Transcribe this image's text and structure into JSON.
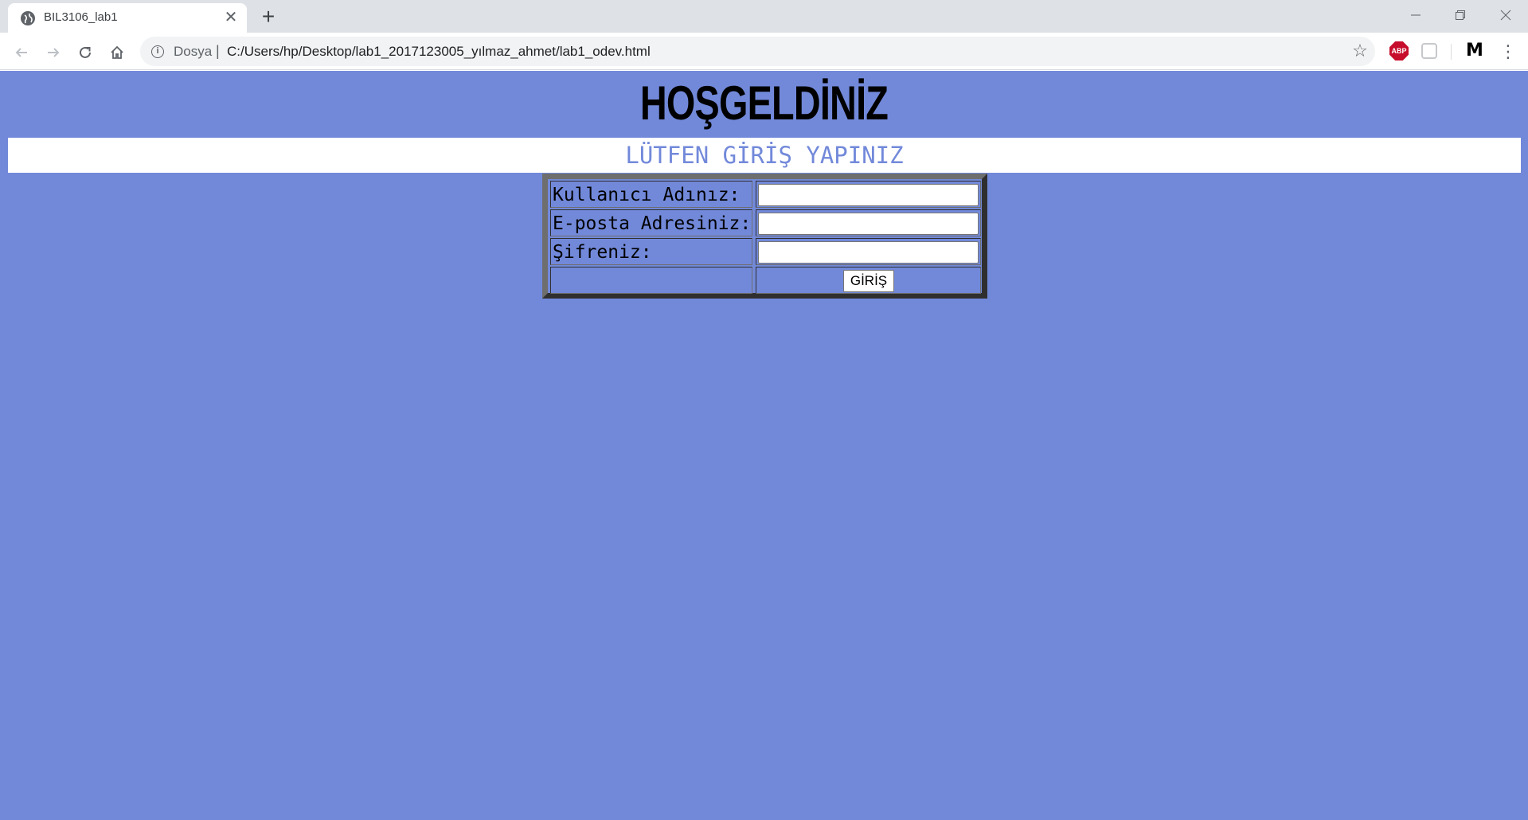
{
  "browser": {
    "tab": {
      "title": "BIL3106_lab1",
      "favicon": "globe-icon",
      "close_icon": "close-icon"
    },
    "new_tab_icon": "plus-icon",
    "window_controls": [
      "minimize-icon",
      "restore-icon",
      "close-icon"
    ],
    "nav": {
      "back_icon": "arrow-left-icon",
      "forward_icon": "arrow-right-icon",
      "reload_icon": "reload-icon",
      "home_icon": "home-icon"
    },
    "omnibox": {
      "info_icon": "info-icon",
      "scheme_label": "Dosya",
      "separator": "|",
      "url": "C:/Users/hp/Desktop/lab1_2017123005_yılmaz_ahmet/lab1_odev.html",
      "bookmark_icon": "star-icon"
    },
    "extensions": [
      {
        "name": "adblock-plus-icon",
        "label": "ABP"
      },
      {
        "name": "pocket-icon",
        "label": ""
      },
      {
        "name": "m-extension-icon",
        "label": "M"
      }
    ],
    "menu_icon": "more-vertical-icon"
  },
  "page": {
    "background_color": "#7289da",
    "heading": "HOŞGELDİNİZ",
    "subheading": "LÜTFEN GİRİŞ YAPINIZ",
    "subheading_color": "#7289da",
    "form": {
      "username_label": "Kullanıcı Adınız:",
      "username_value": "",
      "email_label": "E-posta Adresiniz:",
      "email_value": "",
      "password_label": "Şifreniz:",
      "password_value": "",
      "submit_label": "GİRİŞ"
    }
  }
}
